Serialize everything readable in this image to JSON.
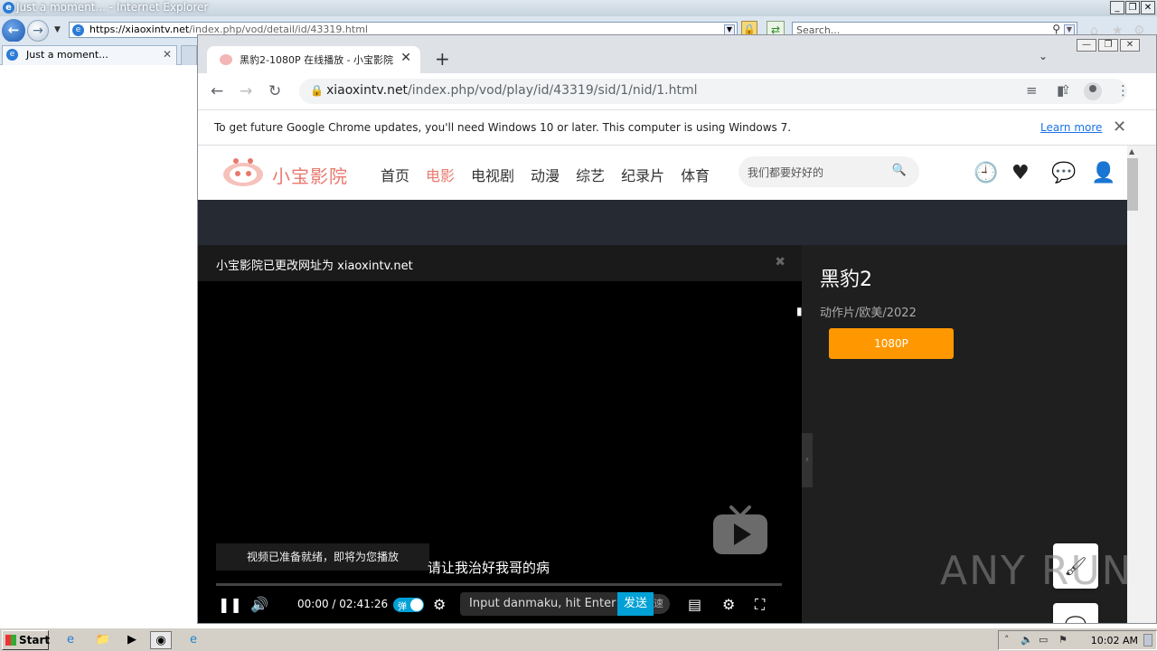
{
  "ie": {
    "window_title": "Just a moment... - Internet Explorer",
    "address": "https://xiaoxintv.net/index.php/vod/detail/id/43319.html",
    "address_host": "https://xiaoxintv.net",
    "address_path": "/index.php/vod/detail/id/43319.html",
    "search_placeholder": "Search...",
    "tab_title": "Just a moment..."
  },
  "chrome": {
    "tab_title": "黑豹2-1080P 在线播放 - 小宝影院 -",
    "url_host": "xiaoxintv.net",
    "url_path": "/index.php/vod/play/id/43319/sid/1/nid/1.html",
    "info_message": "To get future Google Chrome updates, you'll need Windows 10 or later. This computer is using Windows 7.",
    "info_link": "Learn more"
  },
  "site": {
    "logo_text": "小宝影院",
    "nav": [
      {
        "label": "首页",
        "active": false
      },
      {
        "label": "电影",
        "active": true
      },
      {
        "label": "电视剧",
        "active": false
      },
      {
        "label": "动漫",
        "active": false
      },
      {
        "label": "综艺",
        "active": false
      },
      {
        "label": "纪录片",
        "active": false
      },
      {
        "label": "体育",
        "active": false
      }
    ],
    "search_placeholder": "我们都要好好的"
  },
  "player": {
    "notice": "小宝影院已更改网址为 xiaoxintv.net",
    "toast": "视频已准备就绪，即将为您播放",
    "subtitle": "请让我治好我哥的病",
    "time": "00:00 / 02:41:26",
    "danmaku_toggle": "弹",
    "danmaku_placeholder": "Input danmaku, hit Enter",
    "send": "发送",
    "send_tail": "速"
  },
  "detail": {
    "title": "黑豹2",
    "meta": "动作片/欧美/2022",
    "episode": "1080P"
  },
  "watermark": "ANY RUN",
  "taskbar": {
    "start": "Start",
    "time": "10:02 AM"
  }
}
